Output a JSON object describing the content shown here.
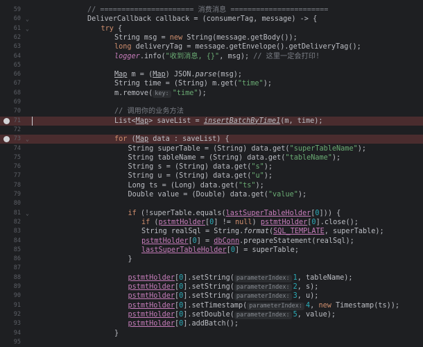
{
  "editor": {
    "lines": [
      {
        "n": "59",
        "fold": "",
        "bp": false,
        "indent": 4,
        "tokens": [
          {
            "t": "// ====================== 消费消息 =======================",
            "c": "cm"
          }
        ]
      },
      {
        "n": "60",
        "fold": "⌄",
        "bp": false,
        "indent": 4,
        "tokens": [
          {
            "t": "DeliverCallback callback = (consumerTag, message) -> {"
          }
        ]
      },
      {
        "n": "61",
        "fold": "⌄",
        "bp": false,
        "indent": 5,
        "tokens": [
          {
            "t": "try",
            "c": "kw"
          },
          {
            "t": " {"
          }
        ]
      },
      {
        "n": "62",
        "fold": "",
        "bp": false,
        "indent": 6,
        "tokens": [
          {
            "t": "String msg = "
          },
          {
            "t": "new",
            "c": "kw"
          },
          {
            "t": " String(message.getBody());"
          }
        ]
      },
      {
        "n": "63",
        "fold": "",
        "bp": false,
        "indent": 6,
        "tokens": [
          {
            "t": "long",
            "c": "kw"
          },
          {
            "t": " deliveryTag = message.getEnvelope().getDeliveryTag();"
          }
        ]
      },
      {
        "n": "64",
        "fold": "",
        "bp": false,
        "indent": 6,
        "tokens": [
          {
            "t": "logger",
            "c": "fld it"
          },
          {
            "t": ".info("
          },
          {
            "t": "\"收到消息, {}\"",
            "c": "str"
          },
          {
            "t": ", msg); "
          },
          {
            "t": "// 这里一定会打印!",
            "c": "cm"
          }
        ]
      },
      {
        "n": "65",
        "fold": "",
        "bp": false,
        "indent": 0,
        "tokens": []
      },
      {
        "n": "66",
        "fold": "",
        "bp": false,
        "indent": 6,
        "tokens": [
          {
            "t": "Map",
            "c": "u"
          },
          {
            "t": " m = ("
          },
          {
            "t": "Map",
            "c": "u"
          },
          {
            "t": ") JSON."
          },
          {
            "t": "parse",
            "c": "it"
          },
          {
            "t": "(msg);"
          }
        ]
      },
      {
        "n": "67",
        "fold": "",
        "bp": false,
        "indent": 6,
        "tokens": [
          {
            "t": "String time = (String) m.get("
          },
          {
            "t": "\"time\"",
            "c": "str"
          },
          {
            "t": ");"
          }
        ]
      },
      {
        "n": "68",
        "fold": "",
        "bp": false,
        "indent": 6,
        "tokens": [
          {
            "t": "m.remove("
          },
          {
            "t": "key:",
            "c": "hint"
          },
          {
            "t": "\"time\"",
            "c": "str"
          },
          {
            "t": ");"
          }
        ]
      },
      {
        "n": "69",
        "fold": "",
        "bp": false,
        "indent": 0,
        "tokens": []
      },
      {
        "n": "70",
        "fold": "",
        "bp": false,
        "indent": 6,
        "tokens": [
          {
            "t": "// 调用你的业务方法",
            "c": "cm"
          }
        ]
      },
      {
        "n": "71",
        "fold": "",
        "bp": true,
        "indent": 6,
        "tokens": [
          {
            "t": "List<"
          },
          {
            "t": "Map",
            "c": "u"
          },
          {
            "t": "> saveList = "
          },
          {
            "t": "insertBatchByTime1",
            "c": "it u"
          },
          {
            "t": "(m, time);"
          }
        ]
      },
      {
        "n": "72",
        "fold": "",
        "bp": false,
        "indent": 0,
        "tokens": []
      },
      {
        "n": "73",
        "fold": "⌄",
        "bp": true,
        "indent": 6,
        "tokens": [
          {
            "t": "for",
            "c": "kw"
          },
          {
            "t": " ("
          },
          {
            "t": "Map",
            "c": "u"
          },
          {
            "t": " data : saveList) {"
          }
        ]
      },
      {
        "n": "74",
        "fold": "",
        "bp": false,
        "indent": 7,
        "tokens": [
          {
            "t": "String superTable = (String) data.get("
          },
          {
            "t": "\"superTableName\"",
            "c": "str"
          },
          {
            "t": ");"
          }
        ]
      },
      {
        "n": "75",
        "fold": "",
        "bp": false,
        "indent": 7,
        "tokens": [
          {
            "t": "String tableName = (String) data.get("
          },
          {
            "t": "\"tableName\"",
            "c": "str"
          },
          {
            "t": ");"
          }
        ]
      },
      {
        "n": "76",
        "fold": "",
        "bp": false,
        "indent": 7,
        "tokens": [
          {
            "t": "String s = (String) data.get("
          },
          {
            "t": "\"s\"",
            "c": "str"
          },
          {
            "t": ");"
          }
        ]
      },
      {
        "n": "77",
        "fold": "",
        "bp": false,
        "indent": 7,
        "tokens": [
          {
            "t": "String u = (String) data.get("
          },
          {
            "t": "\"u\"",
            "c": "str"
          },
          {
            "t": ");"
          }
        ]
      },
      {
        "n": "78",
        "fold": "",
        "bp": false,
        "indent": 7,
        "tokens": [
          {
            "t": "Long ts = (Long) data.get("
          },
          {
            "t": "\"ts\"",
            "c": "str"
          },
          {
            "t": ");"
          }
        ]
      },
      {
        "n": "79",
        "fold": "",
        "bp": false,
        "indent": 7,
        "tokens": [
          {
            "t": "Double value = (Double) data.get("
          },
          {
            "t": "\"value\"",
            "c": "str"
          },
          {
            "t": ");"
          }
        ]
      },
      {
        "n": "80",
        "fold": "",
        "bp": false,
        "indent": 0,
        "tokens": []
      },
      {
        "n": "81",
        "fold": "⌄",
        "bp": false,
        "indent": 7,
        "tokens": [
          {
            "t": "if",
            "c": "kw"
          },
          {
            "t": " (!superTable.equals("
          },
          {
            "t": "lastSuperTableHolder",
            "c": "fld u"
          },
          {
            "t": "["
          },
          {
            "t": "0",
            "c": "num"
          },
          {
            "t": "])) {"
          }
        ]
      },
      {
        "n": "82",
        "fold": "",
        "bp": false,
        "indent": 8,
        "tokens": [
          {
            "t": "if",
            "c": "kw"
          },
          {
            "t": " ("
          },
          {
            "t": "pstmtHolder",
            "c": "fld u"
          },
          {
            "t": "["
          },
          {
            "t": "0",
            "c": "num"
          },
          {
            "t": "] != "
          },
          {
            "t": "null",
            "c": "kw"
          },
          {
            "t": ") "
          },
          {
            "t": "pstmtHolder",
            "c": "fld u"
          },
          {
            "t": "["
          },
          {
            "t": "0",
            "c": "num"
          },
          {
            "t": "].close();"
          }
        ]
      },
      {
        "n": "83",
        "fold": "",
        "bp": false,
        "indent": 8,
        "tokens": [
          {
            "t": "String realSql = String."
          },
          {
            "t": "format",
            "c": "it"
          },
          {
            "t": "("
          },
          {
            "t": "SQL_TEMPLATE",
            "c": "fld u"
          },
          {
            "t": ", superTable);"
          }
        ]
      },
      {
        "n": "84",
        "fold": "",
        "bp": false,
        "indent": 8,
        "tokens": [
          {
            "t": "pstmtHolder",
            "c": "fld u"
          },
          {
            "t": "["
          },
          {
            "t": "0",
            "c": "num"
          },
          {
            "t": "] = "
          },
          {
            "t": "dbConn",
            "c": "fld u"
          },
          {
            "t": ".prepareStatement(realSql);"
          }
        ]
      },
      {
        "n": "85",
        "fold": "",
        "bp": false,
        "indent": 8,
        "tokens": [
          {
            "t": "lastSuperTableHolder",
            "c": "fld u"
          },
          {
            "t": "["
          },
          {
            "t": "0",
            "c": "num"
          },
          {
            "t": "] = superTable;"
          }
        ]
      },
      {
        "n": "86",
        "fold": "",
        "bp": false,
        "indent": 7,
        "tokens": [
          {
            "t": "}"
          }
        ]
      },
      {
        "n": "87",
        "fold": "",
        "bp": false,
        "indent": 0,
        "tokens": []
      },
      {
        "n": "88",
        "fold": "",
        "bp": false,
        "indent": 7,
        "tokens": [
          {
            "t": "pstmtHolder",
            "c": "fld u"
          },
          {
            "t": "["
          },
          {
            "t": "0",
            "c": "num"
          },
          {
            "t": "].setString("
          },
          {
            "t": "parameterIndex:",
            "c": "hint"
          },
          {
            "t": "1",
            "c": "num"
          },
          {
            "t": ", tableName);"
          }
        ]
      },
      {
        "n": "89",
        "fold": "",
        "bp": false,
        "indent": 7,
        "tokens": [
          {
            "t": "pstmtHolder",
            "c": "fld u"
          },
          {
            "t": "["
          },
          {
            "t": "0",
            "c": "num"
          },
          {
            "t": "].setString("
          },
          {
            "t": "parameterIndex:",
            "c": "hint"
          },
          {
            "t": "2",
            "c": "num"
          },
          {
            "t": ", s);"
          }
        ]
      },
      {
        "n": "90",
        "fold": "",
        "bp": false,
        "indent": 7,
        "tokens": [
          {
            "t": "pstmtHolder",
            "c": "fld u"
          },
          {
            "t": "["
          },
          {
            "t": "0",
            "c": "num"
          },
          {
            "t": "].setString("
          },
          {
            "t": "parameterIndex:",
            "c": "hint"
          },
          {
            "t": "3",
            "c": "num"
          },
          {
            "t": ", u);"
          }
        ]
      },
      {
        "n": "91",
        "fold": "",
        "bp": false,
        "indent": 7,
        "tokens": [
          {
            "t": "pstmtHolder",
            "c": "fld u"
          },
          {
            "t": "["
          },
          {
            "t": "0",
            "c": "num"
          },
          {
            "t": "].setTimestamp("
          },
          {
            "t": "parameterIndex:",
            "c": "hint"
          },
          {
            "t": "4",
            "c": "num"
          },
          {
            "t": ", "
          },
          {
            "t": "new",
            "c": "kw"
          },
          {
            "t": " Timestamp(ts));"
          }
        ]
      },
      {
        "n": "92",
        "fold": "",
        "bp": false,
        "indent": 7,
        "tokens": [
          {
            "t": "pstmtHolder",
            "c": "fld u"
          },
          {
            "t": "["
          },
          {
            "t": "0",
            "c": "num"
          },
          {
            "t": "].setDouble("
          },
          {
            "t": "parameterIndex:",
            "c": "hint"
          },
          {
            "t": "5",
            "c": "num"
          },
          {
            "t": ", value);"
          }
        ]
      },
      {
        "n": "93",
        "fold": "",
        "bp": false,
        "indent": 7,
        "tokens": [
          {
            "t": "pstmtHolder",
            "c": "fld u"
          },
          {
            "t": "["
          },
          {
            "t": "0",
            "c": "num"
          },
          {
            "t": "].addBatch();"
          }
        ]
      },
      {
        "n": "94",
        "fold": "",
        "bp": false,
        "indent": 6,
        "tokens": [
          {
            "t": "}"
          }
        ]
      },
      {
        "n": "95",
        "fold": "",
        "bp": false,
        "indent": 0,
        "tokens": []
      }
    ]
  }
}
